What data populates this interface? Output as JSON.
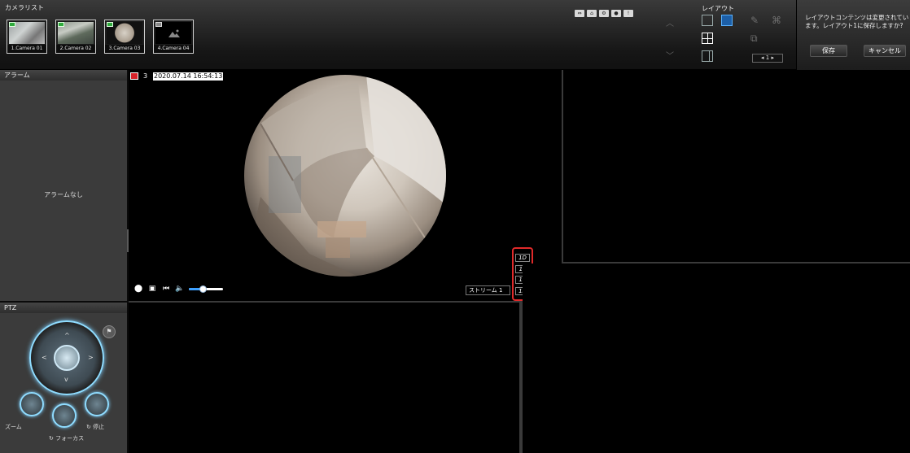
{
  "camera_list": {
    "title": "カメラリスト",
    "cameras": [
      {
        "caption": "1.Camera 01"
      },
      {
        "caption": "2.Camera 02"
      },
      {
        "caption": "3.Camera 03"
      },
      {
        "caption": "4.Camera 04"
      }
    ]
  },
  "layout": {
    "title": "レイアウト",
    "page": "1"
  },
  "message": {
    "text": "レイアウトコンテンツは変更されています。レイアウト1に保存しますか?",
    "save_label": "保存",
    "cancel_label": "キャンセル"
  },
  "alarm": {
    "title": "アラーム",
    "empty_text": "アラームなし"
  },
  "ptz": {
    "title": "PTZ",
    "zoom_label": "ズーム",
    "focus_label": "フォーカス",
    "stop_label": "停止"
  },
  "video": {
    "camera_number": "3",
    "timestamp": "2020.07.14 16:54:13",
    "stream_label": "ストリーム 1",
    "rate_options": [
      "1D",
      "1P",
      "1R",
      "1D"
    ],
    "callout_number": "1",
    "volume_level": 0.4
  },
  "colors": {
    "accent_blue": "#3da0ff",
    "rec_red": "#d8232a",
    "highlight_red": "#e02a2a",
    "status_green": "#2faa3c"
  }
}
